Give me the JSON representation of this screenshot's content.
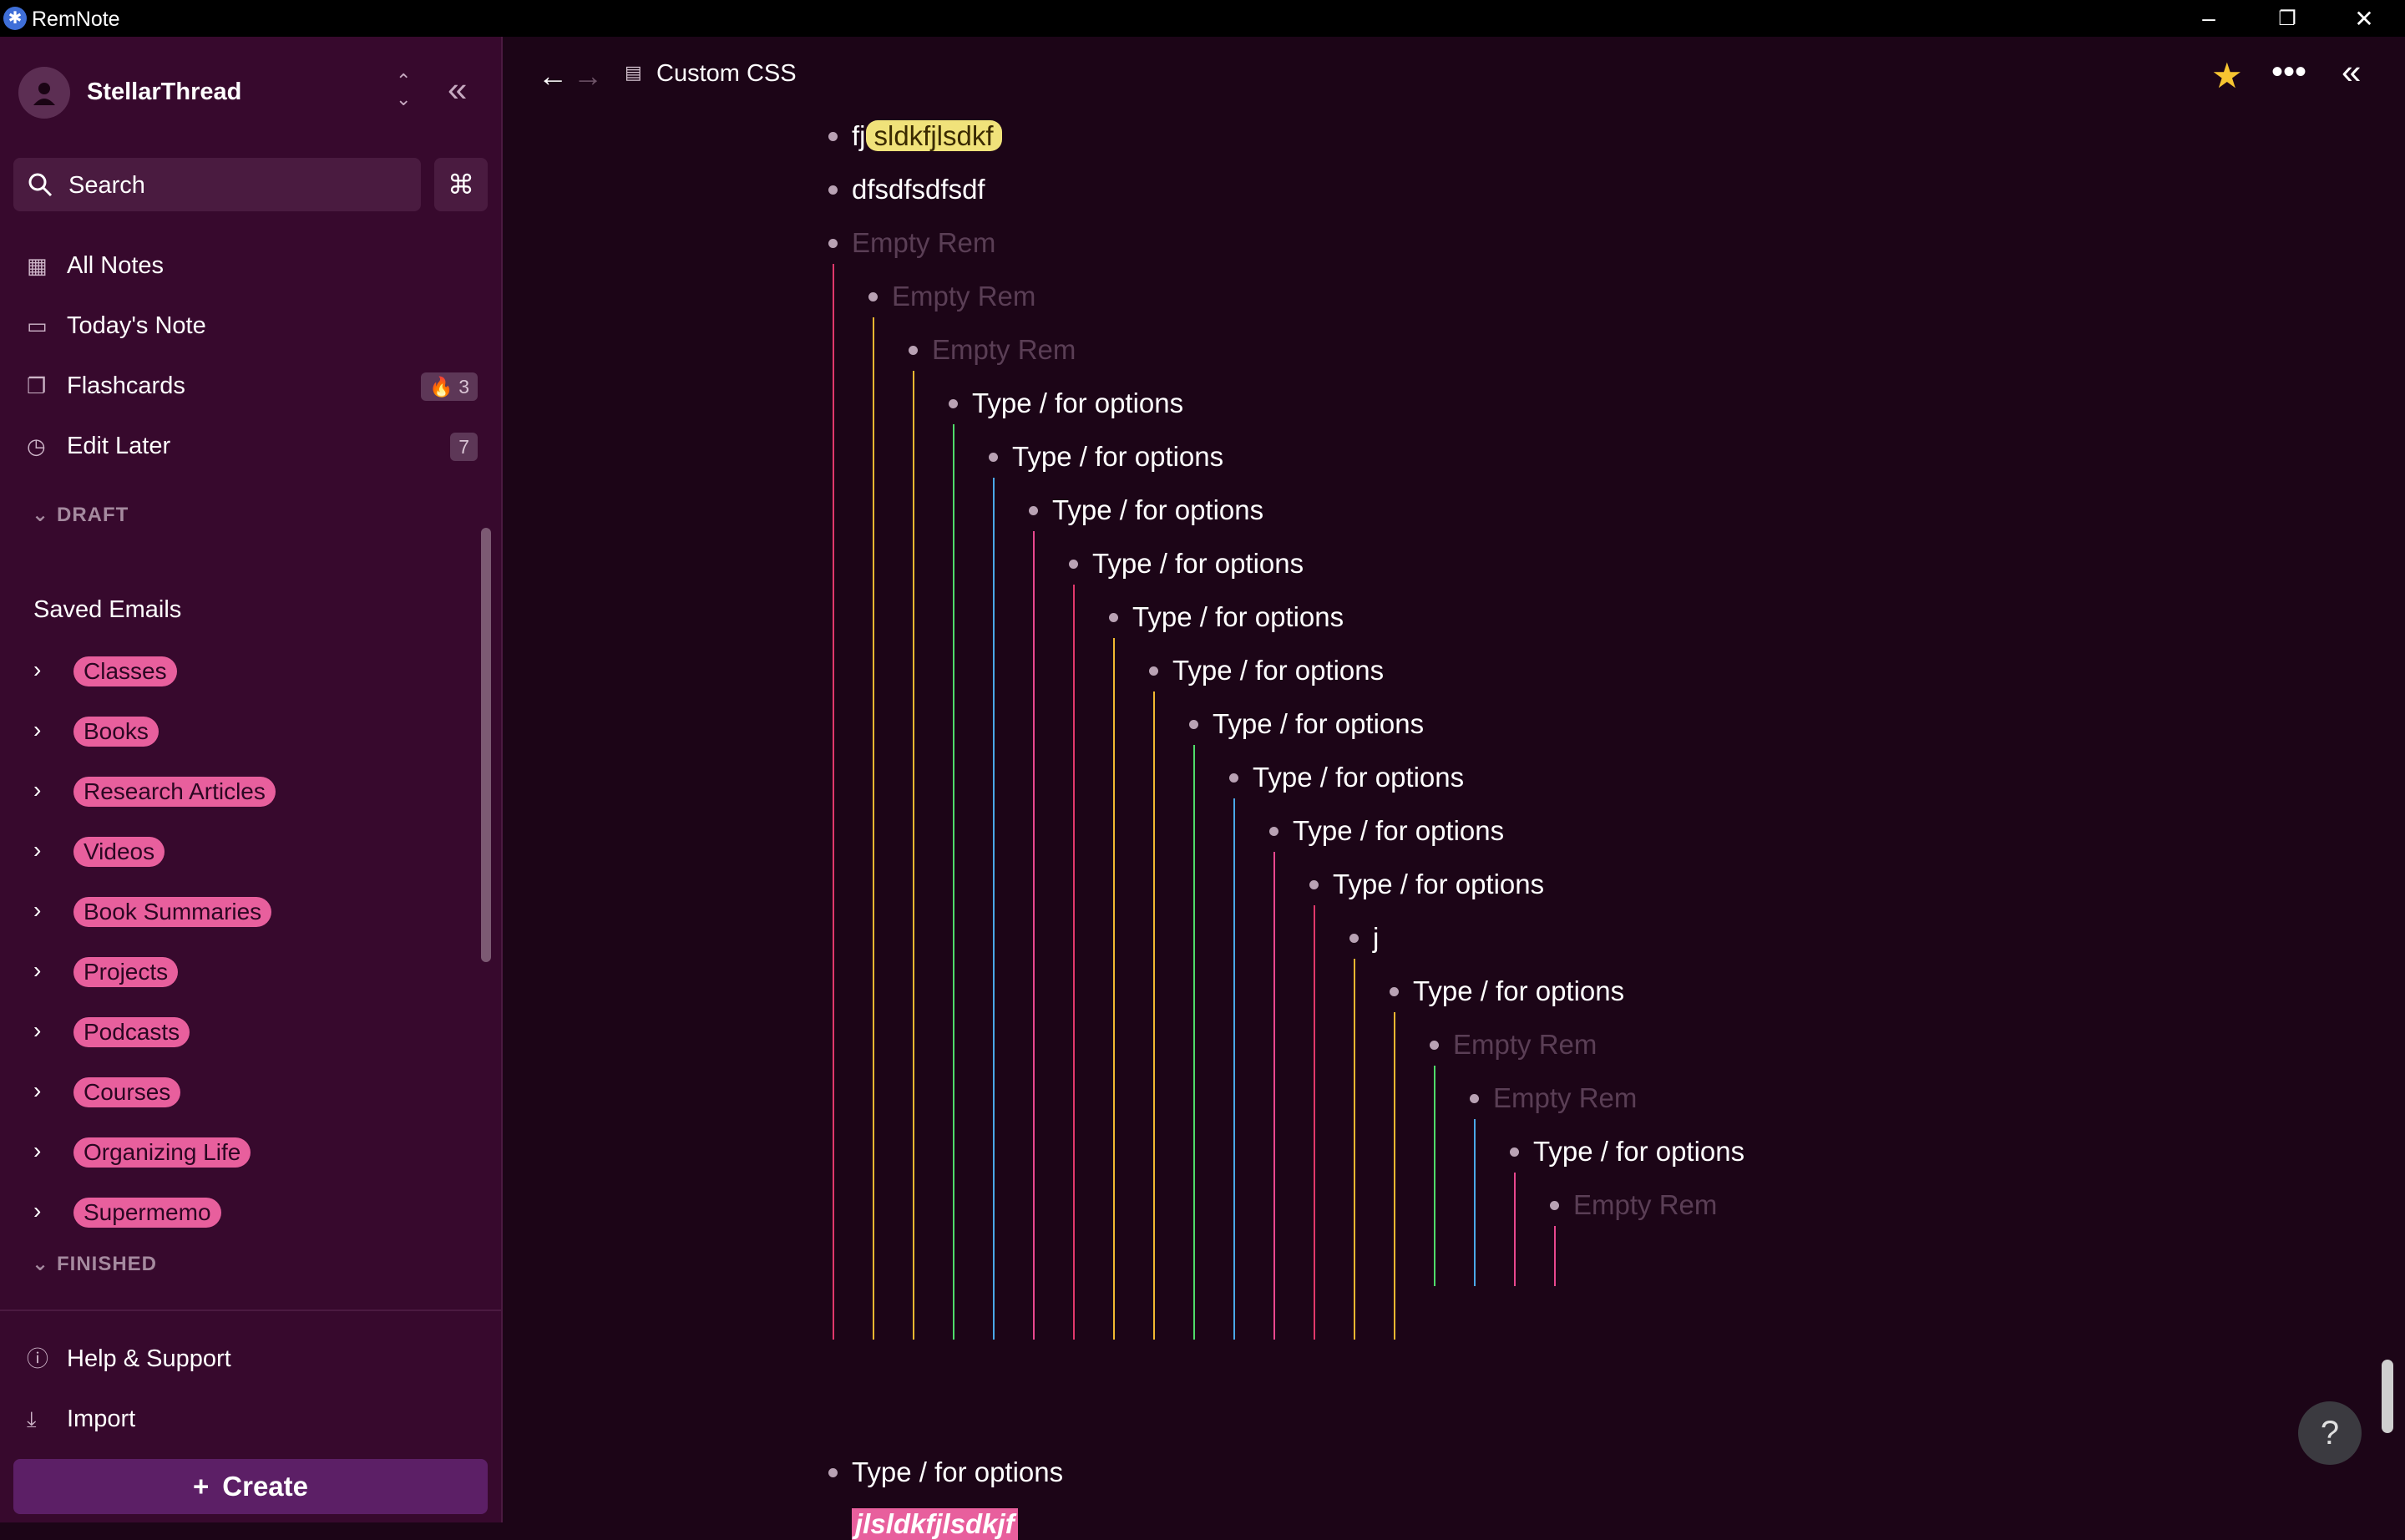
{
  "window": {
    "app_name": "RemNote",
    "minimize": "–",
    "restore": "❐",
    "close": "✕"
  },
  "sidebar": {
    "workspace": "StellarThread",
    "search_label": "Search",
    "cmd_label": "⌘",
    "nav": [
      {
        "label": "All Notes",
        "icon": "grid-icon",
        "badge": ""
      },
      {
        "label": "Today's Note",
        "icon": "calendar-icon",
        "badge": ""
      },
      {
        "label": "Flashcards",
        "icon": "flashcards-icon",
        "badge": "3"
      },
      {
        "label": "Edit Later",
        "icon": "clock-icon",
        "badge": "7"
      }
    ],
    "draft_section": "DRAFT",
    "saved_emails": "Saved Emails",
    "tags": [
      "Classes",
      "Books",
      "Research Articles",
      "Videos",
      "Book Summaries",
      "Projects",
      "Podcasts",
      "Courses",
      "Organizing Life",
      "Supermemo"
    ],
    "finished_section": "FINISHED",
    "help": "Help & Support",
    "import": "Import",
    "create": "Create"
  },
  "topbar": {
    "breadcrumb": "Custom CSS"
  },
  "editor": {
    "line0_prefix": "fj",
    "line0_highlight": "sldkfjlsdkf",
    "rems": [
      {
        "text": "dfsdfsdfsdf",
        "muted": false,
        "level": 0
      },
      {
        "text": "Empty Rem",
        "muted": true,
        "level": 0
      },
      {
        "text": "Empty Rem",
        "muted": true,
        "level": 1
      },
      {
        "text": "Empty Rem",
        "muted": true,
        "level": 2
      },
      {
        "text": "Type / for options",
        "muted": false,
        "level": 3
      },
      {
        "text": "Type / for options",
        "muted": false,
        "level": 4
      },
      {
        "text": "Type / for options",
        "muted": false,
        "level": 5
      },
      {
        "text": "Type / for options",
        "muted": false,
        "level": 6
      },
      {
        "text": "Type / for options",
        "muted": false,
        "level": 7
      },
      {
        "text": "Type / for options",
        "muted": false,
        "level": 8
      },
      {
        "text": "Type / for options",
        "muted": false,
        "level": 9
      },
      {
        "text": "Type / for options",
        "muted": false,
        "level": 10
      },
      {
        "text": "Type / for options",
        "muted": false,
        "level": 11
      },
      {
        "text": "Type / for options",
        "muted": false,
        "level": 12
      },
      {
        "text": "j",
        "muted": false,
        "level": 13
      },
      {
        "text": "Type / for options",
        "muted": false,
        "level": 14
      },
      {
        "text": "Empty Rem",
        "muted": true,
        "level": 15
      },
      {
        "text": "Empty Rem",
        "muted": true,
        "level": 16
      },
      {
        "text": "Type / for options",
        "muted": false,
        "level": 17
      },
      {
        "text": "Empty Rem",
        "muted": true,
        "level": 18
      }
    ],
    "bottom_rem": "Type / for options",
    "bottom_partial": "jlsldkfjlsdkjf",
    "help_button": "?"
  },
  "colors": {
    "indent_guides": [
      "#e0386b",
      "#f2b731",
      "#f2b731",
      "#4fdc6a",
      "#4aa8e8",
      "#e8478e",
      "#e0386b",
      "#f2b731",
      "#f2b731",
      "#4fdc6a",
      "#4aa8e8",
      "#e8478e",
      "#e0386b",
      "#f2b731",
      "#f2b731",
      "#4fdc6a",
      "#4aa8e8",
      "#e8478e",
      "#e8478e"
    ],
    "accent_tag": "#e85f9d",
    "highlight": "#f0e27a"
  }
}
